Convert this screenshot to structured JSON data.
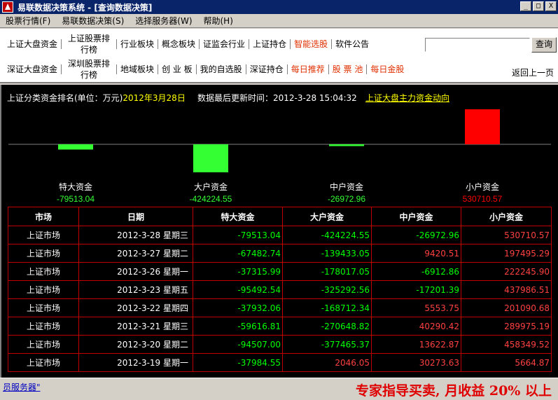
{
  "window": {
    "title": "易联数据决策系统 - [查询数据决策]",
    "minimize": "_",
    "maximize": "□",
    "close": "X"
  },
  "menu": [
    "股票行情(F)",
    "易联数据决策(S)",
    "选择服务器(W)",
    "帮助(H)"
  ],
  "toolbar": {
    "row1": [
      {
        "label": "上证大盘资金",
        "color": "normal"
      },
      {
        "label": "上证股票排行榜",
        "color": "normal",
        "two_line": true
      },
      {
        "label": "行业板块",
        "color": "normal"
      },
      {
        "label": "概念板块",
        "color": "normal"
      },
      {
        "label": "证监会行业",
        "color": "normal"
      },
      {
        "label": "上证持仓",
        "color": "normal"
      },
      {
        "label": "智能选股",
        "color": "red"
      },
      {
        "label": "软件公告",
        "color": "normal"
      }
    ],
    "row2": [
      {
        "label": "深证大盘资金",
        "color": "normal"
      },
      {
        "label": "深圳股票排行榜",
        "color": "normal",
        "two_line": true
      },
      {
        "label": "地域板块",
        "color": "normal"
      },
      {
        "label": "创 业 板",
        "color": "normal"
      },
      {
        "label": "我的自选股",
        "color": "normal"
      },
      {
        "label": "深证持仓",
        "color": "normal"
      },
      {
        "label": "每日推荐",
        "color": "red"
      },
      {
        "label": "股 票 池",
        "color": "red"
      },
      {
        "label": "每日金股",
        "color": "red"
      }
    ],
    "search_value": "",
    "search_button": "查询",
    "back_label": "返回上一页"
  },
  "info": {
    "ranking_label": "上证分类资金排名(单位：万元)",
    "ranking_date": "2012年3月28日",
    "update_label": "数据最后更新时间：2012-3-28 15:04:32",
    "trend_link": "上证大盘主力资金动向"
  },
  "chart_data": {
    "type": "bar",
    "categories": [
      "特大资金",
      "大户资金",
      "中户资金",
      "小户资金"
    ],
    "values": [
      -79513.04,
      -424224.55,
      -26972.96,
      530710.57
    ],
    "value_labels": [
      "-79513.04",
      "-424224.55",
      "-26972.96",
      "530710.57"
    ],
    "colors": {
      "negative": "#33ff33",
      "positive": "#ff0000"
    }
  },
  "table": {
    "headers": [
      "市场",
      "日期",
      "特大资金",
      "大户资金",
      "中户资金",
      "小户资金"
    ],
    "rows": [
      [
        "上证市场",
        "2012-3-28 星期三",
        "-79513.04",
        "-424224.55",
        "-26972.96",
        "530710.57"
      ],
      [
        "上证市场",
        "2012-3-27 星期二",
        "-67482.74",
        "-139433.05",
        "9420.51",
        "197495.29"
      ],
      [
        "上证市场",
        "2012-3-26 星期一",
        "-37315.99",
        "-178017.05",
        "-6912.86",
        "222245.90"
      ],
      [
        "上证市场",
        "2012-3-23 星期五",
        "-95492.54",
        "-325292.56",
        "-17201.39",
        "437986.51"
      ],
      [
        "上证市场",
        "2012-3-22 星期四",
        "-37932.06",
        "-168712.34",
        "5553.75",
        "201090.68"
      ],
      [
        "上证市场",
        "2012-3-21 星期三",
        "-59616.81",
        "-270648.82",
        "40290.42",
        "289975.19"
      ],
      [
        "上证市场",
        "2012-3-20 星期二",
        "-94507.00",
        "-377465.37",
        "13622.87",
        "458349.52"
      ],
      [
        "上证市场",
        "2012-3-19 星期一",
        "-37984.55",
        "2046.05",
        "30273.63",
        "5664.87"
      ]
    ]
  },
  "status": {
    "left_text": "员服务器\"",
    "promo": "专家指导买卖, 月收益 20% 以上"
  }
}
